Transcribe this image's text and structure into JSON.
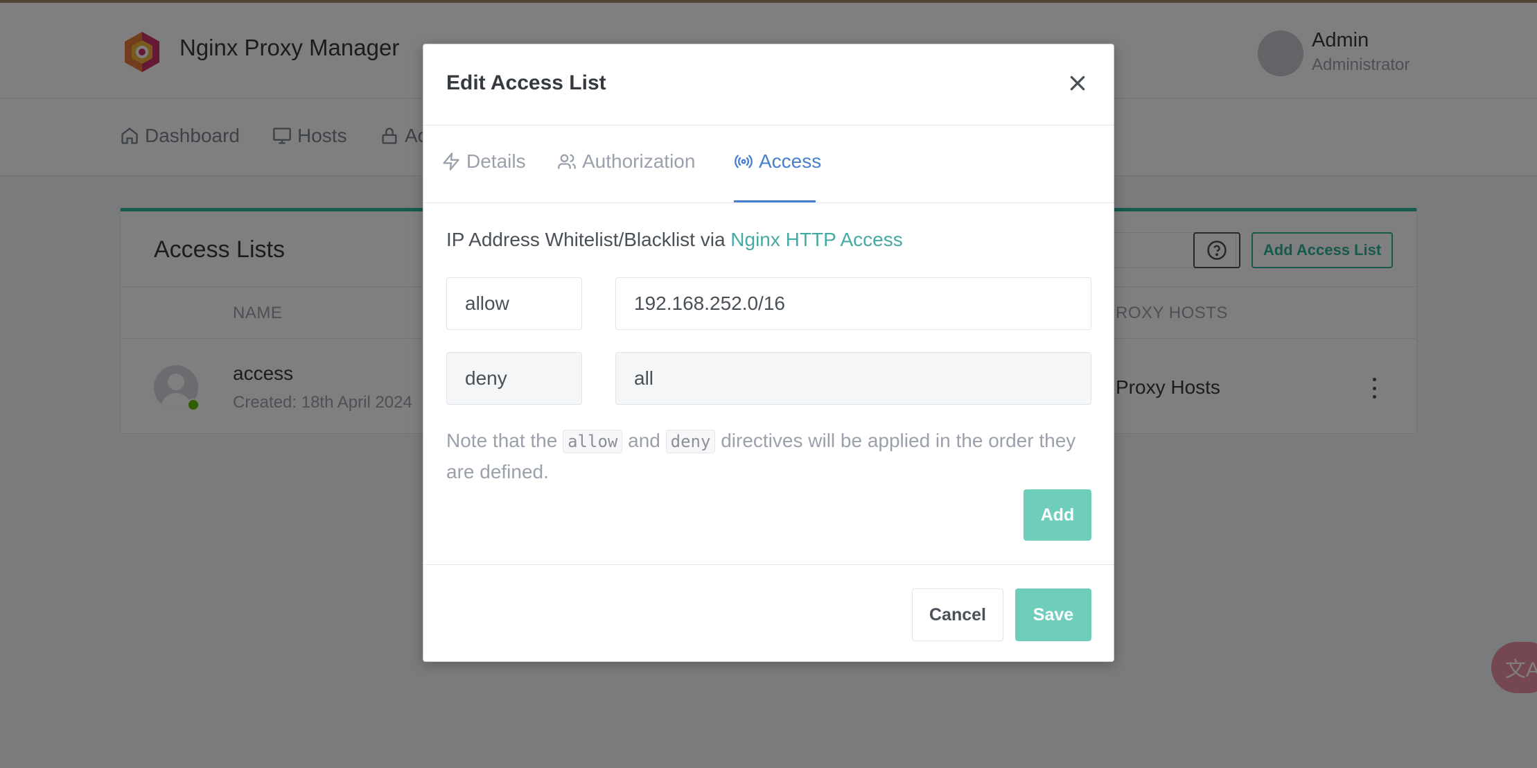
{
  "app": {
    "brand": "Nginx Proxy Manager",
    "user_name": "Admin",
    "user_role": "Administrator"
  },
  "nav": {
    "items": [
      {
        "label": "Dashboard",
        "icon": "home-icon"
      },
      {
        "label": "Hosts",
        "icon": "monitor-icon"
      },
      {
        "label": "Ac",
        "icon": "lock-icon"
      }
    ]
  },
  "card": {
    "title": "Access Lists",
    "add_button": "Add Access List",
    "columns": [
      "NAME",
      "ROXY HOSTS"
    ],
    "rows": [
      {
        "name": "access",
        "created": "Created: 18th April 2024",
        "hosts": "Proxy Hosts"
      }
    ]
  },
  "fab": {
    "label": "文A"
  },
  "modal": {
    "title": "Edit Access List",
    "tabs": [
      {
        "label": "Details",
        "icon": "lightning-icon"
      },
      {
        "label": "Authorization",
        "icon": "users-icon"
      },
      {
        "label": "Access",
        "icon": "broadcast-icon"
      }
    ],
    "active_tab": "Access",
    "intro_prefix": "IP Address Whitelist/Blacklist via ",
    "intro_link": "Nginx HTTP Access",
    "rules": [
      {
        "directive": "allow",
        "address": "192.168.252.0/16"
      },
      {
        "directive": "deny",
        "address": "all"
      }
    ],
    "note_part1": "Note that the ",
    "note_code1": "allow",
    "note_part2": " and ",
    "note_code2": "deny",
    "note_part3": " directives will be applied in the order they are defined.",
    "add_button": "Add",
    "cancel_button": "Cancel",
    "save_button": "Save"
  },
  "colors": {
    "accent_teal": "#2fb39a",
    "button_teal": "#6fcebb",
    "active_tab": "#467fcf",
    "link": "#45aaa2"
  }
}
